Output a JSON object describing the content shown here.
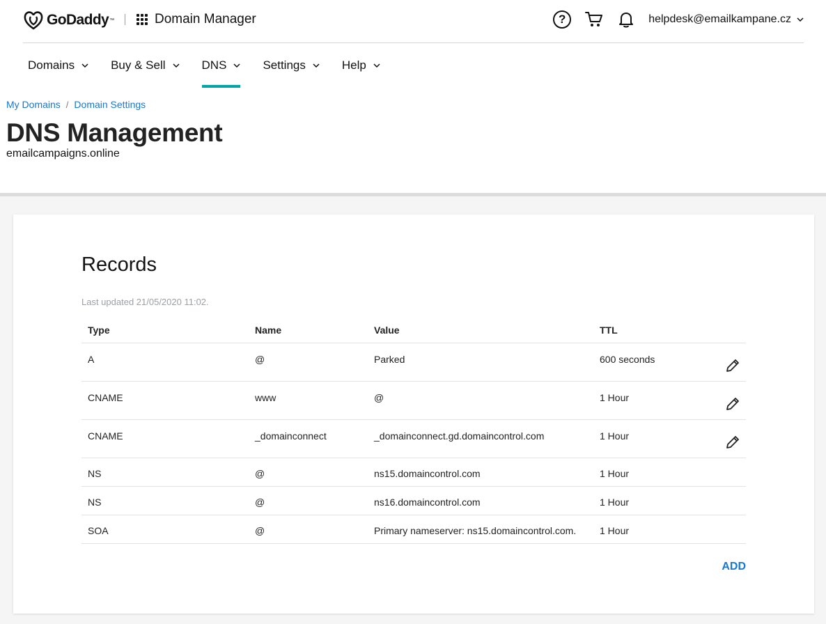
{
  "header": {
    "brand": "GoDaddy",
    "app_title": "Domain Manager",
    "account": "helpdesk@emailkampane.cz"
  },
  "nav": {
    "items": [
      {
        "label": "Domains"
      },
      {
        "label": "Buy & Sell"
      },
      {
        "label": "DNS"
      },
      {
        "label": "Settings"
      },
      {
        "label": "Help"
      }
    ],
    "active": "DNS"
  },
  "breadcrumb": [
    "My Domains",
    "Domain Settings"
  ],
  "page": {
    "title": "DNS Management",
    "domain": "emailcampaigns.online"
  },
  "records": {
    "title": "Records",
    "last_updated": "Last updated 21/05/2020 11:02.",
    "columns": [
      "Type",
      "Name",
      "Value",
      "TTL"
    ],
    "rows": [
      {
        "type": "A",
        "name": "@",
        "value": "Parked",
        "ttl": "600 seconds"
      },
      {
        "type": "CNAME",
        "name": "www",
        "value": "@",
        "ttl": "1 Hour"
      },
      {
        "type": "CNAME",
        "name": "_domainconnect",
        "value": "_domainconnect.gd.domaincontrol.com",
        "ttl": "1 Hour"
      },
      {
        "type": "NS",
        "name": "@",
        "value": "ns15.domaincontrol.com",
        "ttl": "1 Hour"
      },
      {
        "type": "NS",
        "name": "@",
        "value": "ns16.domaincontrol.com",
        "ttl": "1 Hour"
      },
      {
        "type": "SOA",
        "name": "@",
        "value": "Primary nameserver: ns15.domaincontrol.com.",
        "ttl": "1 Hour"
      }
    ],
    "add_label": "ADD"
  },
  "icons": {
    "help": "help-circle-icon",
    "cart": "cart-icon",
    "bell": "bell-icon",
    "edit": "pencil-icon",
    "apps": "app-grid-icon"
  },
  "colors": {
    "accent": "#00a4a6",
    "link": "#1976d2"
  }
}
